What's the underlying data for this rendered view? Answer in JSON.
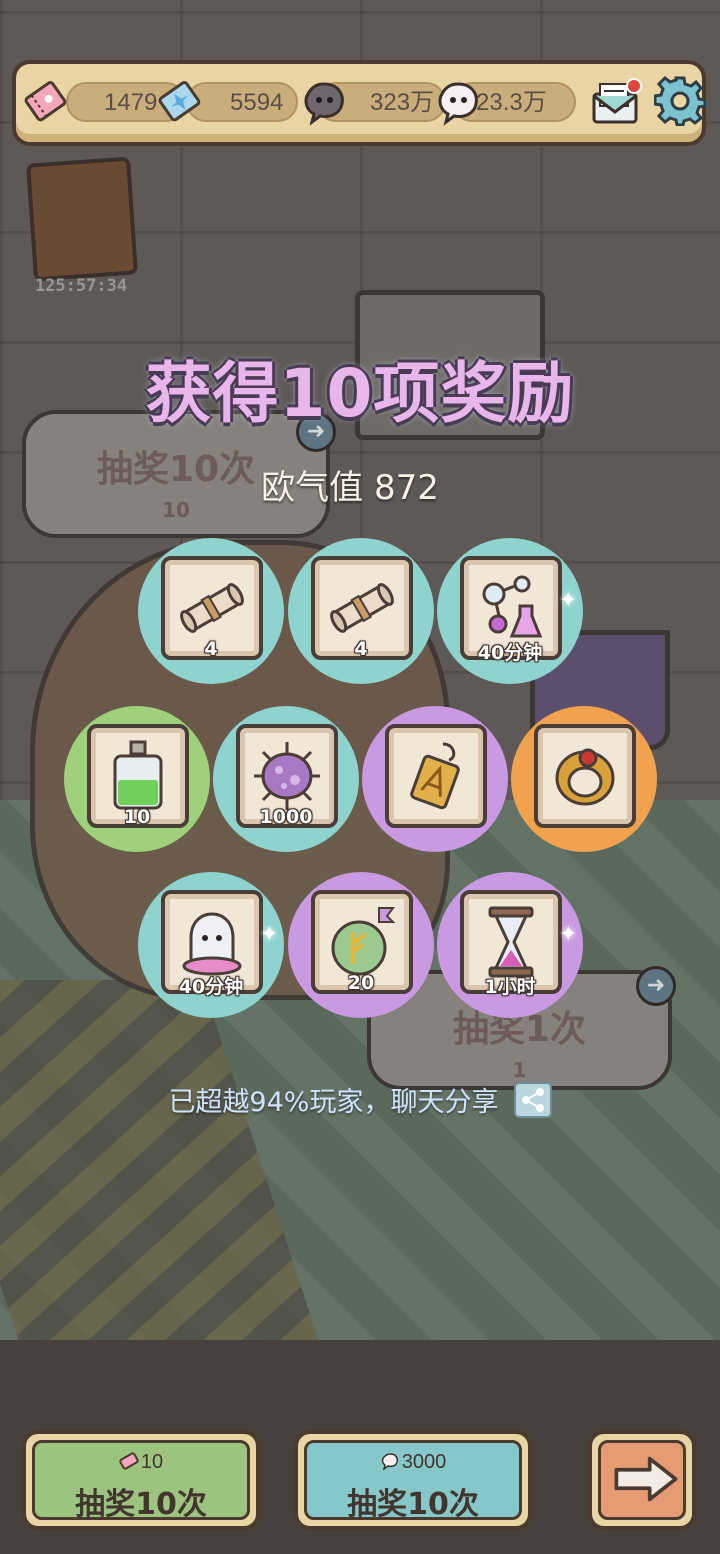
{
  "resources": {
    "tickets": "1479",
    "crystals": "5594",
    "dark_souls": "323万",
    "light_souls": "23.3万"
  },
  "background": {
    "event_timer": "125:57:34",
    "draw10_label": "抽奖10次",
    "draw10_cost": "10",
    "draw1_label": "抽奖1次",
    "draw1_cost": "1"
  },
  "reward_panel": {
    "title": "获得10项奖励",
    "luck_text": "欧气值 872",
    "share_text": "已超越94%玩家，聊天分享",
    "rewards": [
      {
        "item": "scroll-icon",
        "qty": "4",
        "rarity": "blue"
      },
      {
        "item": "scroll-icon",
        "qty": "4",
        "rarity": "blue"
      },
      {
        "item": "molecule-flask-icon",
        "qty": "40分钟",
        "rarity": "blue"
      },
      {
        "item": "potion-bottle-icon",
        "qty": "10",
        "rarity": "green"
      },
      {
        "item": "virus-cell-icon",
        "qty": "1000",
        "rarity": "blue"
      },
      {
        "item": "amulet-icon",
        "qty": "",
        "rarity": "purple"
      },
      {
        "item": "ring-icon",
        "qty": "",
        "rarity": "orange"
      },
      {
        "item": "ghost-icon",
        "qty": "40分钟",
        "rarity": "blue"
      },
      {
        "item": "rune-stone-icon",
        "qty": "20",
        "rarity": "purple"
      },
      {
        "item": "hourglass-icon",
        "qty": "1小时",
        "rarity": "purple"
      }
    ]
  },
  "bottom_buttons": {
    "ticket_draw": {
      "cost": "10",
      "label": "抽奖10次"
    },
    "soul_draw": {
      "cost": "3000",
      "label": "抽奖10次"
    }
  },
  "colors": {
    "rarity_blue": "#8fd3cf",
    "rarity_green": "#9fd17a",
    "rarity_purple": "#c99ae2",
    "rarity_orange": "#f0a24d",
    "panel_cream": "#e9d4a4",
    "outline": "#4a3a2f"
  }
}
